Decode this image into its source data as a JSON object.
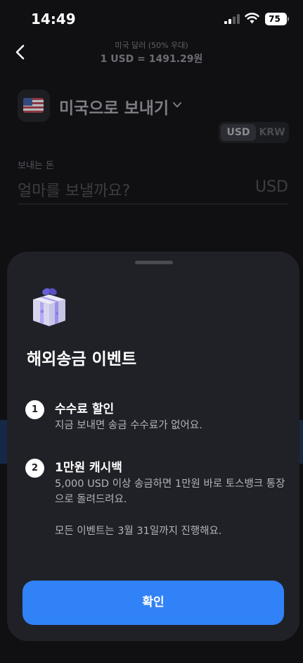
{
  "status_bar": {
    "time": "14:49",
    "battery_level": "75",
    "icons": [
      "signal-icon",
      "wifi-icon",
      "battery-icon"
    ]
  },
  "header": {
    "back_icon": "chevron-left-icon",
    "rate_subtitle": "미국 달러 (50% 우대)",
    "rate_main": "1 USD = 1491.29원"
  },
  "destination": {
    "flag_icon": "us-flag-icon",
    "title": "미국으로 보내기",
    "dropdown_icon": "chevron-down-icon"
  },
  "currency_toggle": {
    "options": [
      "USD",
      "KRW"
    ],
    "selected": "USD"
  },
  "amount": {
    "label": "보내는 돈",
    "placeholder": "얼마를 보낼까요?",
    "unit": "USD"
  },
  "sheet": {
    "gift_icon": "gift-box-icon",
    "title": "해외송금 이벤트",
    "benefits": [
      {
        "number": "1",
        "title": "수수료 할인",
        "description": "지금 보내면 송금 수수료가 없어요."
      },
      {
        "number": "2",
        "title": "1만원 캐시백",
        "description": "5,000 USD 이상 송금하면 1만원 바로 토스뱅크 통장으로 돌려드려요."
      }
    ],
    "note": "모든 이벤트는 3월 31일까지 진행해요.",
    "confirm_label": "확인"
  },
  "colors": {
    "accent": "#3182f6",
    "sheet_background": "#202127",
    "page_background": "#101013"
  }
}
